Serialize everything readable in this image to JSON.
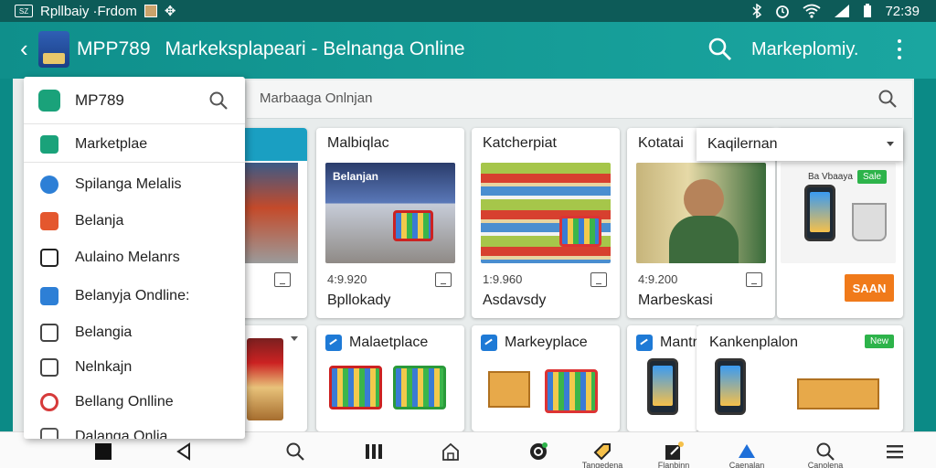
{
  "status_bar": {
    "left_badge": "SZ",
    "left_text": "Rpllbaiy ·Frdom",
    "right_arrows": "✥",
    "time": "72:39"
  },
  "app_bar": {
    "back": "‹",
    "code": "MPP789",
    "title": "Markeksplapeari - Belnanga Online",
    "right_label": "Markeplomiy."
  },
  "search": {
    "placeholder": "Marbaaga Onlnjan"
  },
  "drawer": {
    "header": "MP789",
    "items": [
      {
        "label": "Marketplae",
        "icon": "store-icon",
        "color": "#1aa27a"
      },
      {
        "label": "Spilanga Melalis",
        "icon": "search-circle-icon",
        "color": "#2d7fd6"
      },
      {
        "label": "Belanja",
        "icon": "shopping-tag-icon",
        "color": "#e4572e"
      },
      {
        "label": "Aulaino Melanrs",
        "icon": "grid-list-icon",
        "color": "#222222"
      },
      {
        "label": "Belanyja Ondline:",
        "icon": "chat-icon",
        "color": "#2d7fd6"
      },
      {
        "label": "Belangia",
        "icon": "shopping-bag-icon",
        "color": "#444444"
      },
      {
        "label": "Nelnkajn",
        "icon": "checkbox-icon",
        "color": "#444444"
      },
      {
        "label": "Bellang Onlline",
        "icon": "record-icon",
        "color": "#d63a3a"
      },
      {
        "label": "Dalanga Onlia",
        "icon": "image-icon",
        "color": "#555555"
      }
    ]
  },
  "cards_row1": [
    {
      "title": "Malbiqlac",
      "price": "4:9.920",
      "name": "Bpllokady",
      "img_text": "Belanjan"
    },
    {
      "title": "Katcherpiat",
      "price": "1:9.960",
      "name": "Asdavsdy"
    },
    {
      "title": "Kotatai",
      "price": "4:9.200",
      "name": "Marbeskasi"
    }
  ],
  "cards_row2": [
    {
      "title": "Malaetplace"
    },
    {
      "title": "Markeyplace"
    },
    {
      "title": "Mantra"
    },
    {
      "title": "Kankenplalon"
    }
  ],
  "right_card": {
    "badge": "Ba Vbaaya",
    "button": "SAAN"
  },
  "right_card2": {
    "badge": "New"
  },
  "dropdown": {
    "label": "Kaqilernan"
  },
  "bottom_nav": [
    {
      "name": "nav-home-square",
      "label": ""
    },
    {
      "name": "nav-back",
      "label": ""
    },
    {
      "name": "nav-search",
      "label": ""
    },
    {
      "name": "nav-recents",
      "label": ""
    },
    {
      "name": "nav-home",
      "label": ""
    },
    {
      "name": "nav-orders",
      "label": ""
    },
    {
      "name": "nav-promo",
      "label": "Tangedena"
    },
    {
      "name": "nav-edit",
      "label": "Flanbinn"
    },
    {
      "name": "nav-account",
      "label": "Caenalan"
    },
    {
      "name": "nav-find",
      "label": "Canolena"
    },
    {
      "name": "nav-menu",
      "label": ""
    }
  ]
}
